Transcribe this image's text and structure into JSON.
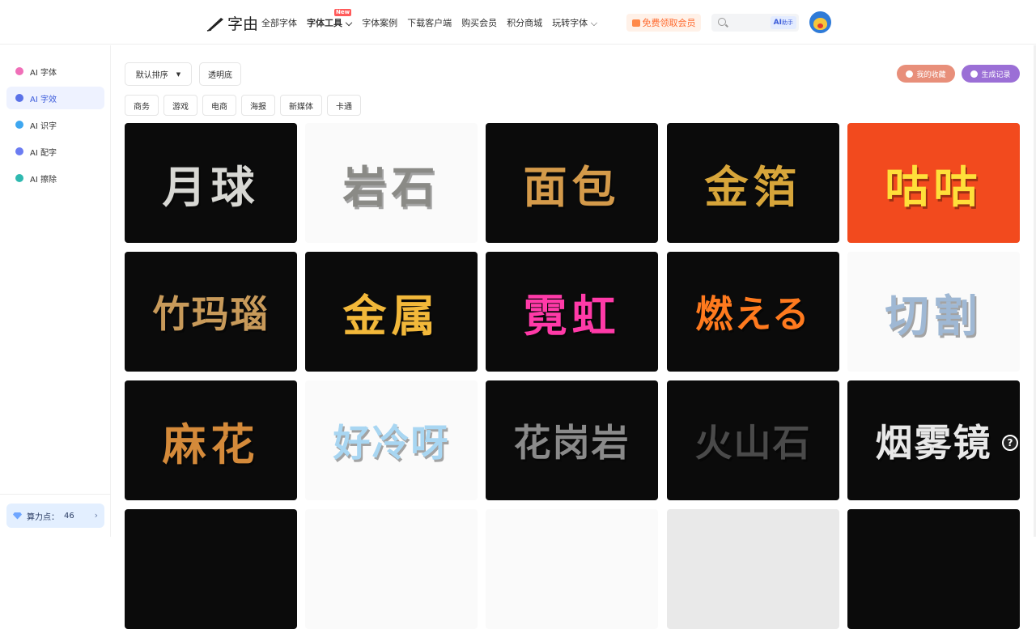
{
  "brand": {
    "name": "字由"
  },
  "nav": {
    "items": [
      {
        "label": "全部字体",
        "bold": false
      },
      {
        "label": "字体工具",
        "bold": true,
        "caret": true,
        "badge": "New"
      },
      {
        "label": "字体案例"
      },
      {
        "label": "下载客户端"
      },
      {
        "label": "购买会员"
      },
      {
        "label": "积分商城"
      },
      {
        "label": "玩转字体",
        "caret": true
      }
    ]
  },
  "vip_button": "免费领取会员",
  "search": {
    "placeholder": "",
    "ai_label": "AI",
    "ai_sub": "助手"
  },
  "sidebar": {
    "items": [
      {
        "label": "AI 字体",
        "icon": "diamond-icon",
        "color": "#f06fb8"
      },
      {
        "label": "AI 字效",
        "icon": "star-icon",
        "color": "#5a72e8",
        "active": true
      },
      {
        "label": "AI 识字",
        "icon": "scan-icon",
        "color": "#3ea7f0"
      },
      {
        "label": "AI 配字",
        "icon": "image-icon",
        "color": "#6b7cf2"
      },
      {
        "label": "AI 擦除",
        "icon": "eraser-icon",
        "color": "#2fb9b0"
      }
    ]
  },
  "points": {
    "label": "算力点：",
    "value": "46"
  },
  "toolbar": {
    "sort": "默认排序",
    "transparent": "透明底",
    "favorites": "我的收藏",
    "history": "生成记录"
  },
  "tags": [
    "商务",
    "游戏",
    "电商",
    "海报",
    "新媒体",
    "卡通"
  ],
  "cards": [
    {
      "text": "月球",
      "bg": "#0b0b0b",
      "fg": "#d8d8d4"
    },
    {
      "text": "岩石",
      "bg": "#ffffff",
      "fg": "#8a8a86"
    },
    {
      "text": "面包",
      "bg": "#0b0b0b",
      "fg": "#d49a4a"
    },
    {
      "text": "金箔",
      "bg": "#0b0b0b",
      "fg": "#d7a53a"
    },
    {
      "text": "咕咕",
      "bg": "#f24a1e",
      "fg": "#ffe03a"
    },
    {
      "text": "竹玛瑙",
      "bg": "#0b0b0b",
      "fg": "#c89a5a"
    },
    {
      "text": "金属",
      "bg": "#0b0b0b",
      "fg": "#f2b83a"
    },
    {
      "text": "霓虹",
      "bg": "#0b0b0b",
      "fg": "#ff3aa8"
    },
    {
      "text": "燃える",
      "bg": "#0b0b0b",
      "fg": "#ff7a1e"
    },
    {
      "text": "切割",
      "bg": "#ffffff",
      "fg": "#9fb8d4"
    },
    {
      "text": "麻花",
      "bg": "#0b0b0b",
      "fg": "#d48a3a"
    },
    {
      "text": "好冷呀",
      "bg": "#ffffff",
      "fg": "#a8d6f2"
    },
    {
      "text": "花岗岩",
      "bg": "#0b0b0b",
      "fg": "#8a8a8a"
    },
    {
      "text": "火山石",
      "bg": "#0b0b0b",
      "fg": "#4a4a4a"
    },
    {
      "text": "烟雾镜",
      "bg": "#0b0b0b",
      "fg": "#e8e8e8"
    },
    {
      "text": "",
      "bg": "#0b0b0b",
      "fg": "#fff"
    },
    {
      "text": "",
      "bg": "#ffffff",
      "fg": "#fff"
    },
    {
      "text": "",
      "bg": "#ffffff",
      "fg": "#fff"
    },
    {
      "text": "",
      "bg": "#e9e9e9",
      "fg": "#fff"
    },
    {
      "text": "",
      "bg": "#0b0b0b",
      "fg": "#fff"
    }
  ],
  "help_label": "?"
}
